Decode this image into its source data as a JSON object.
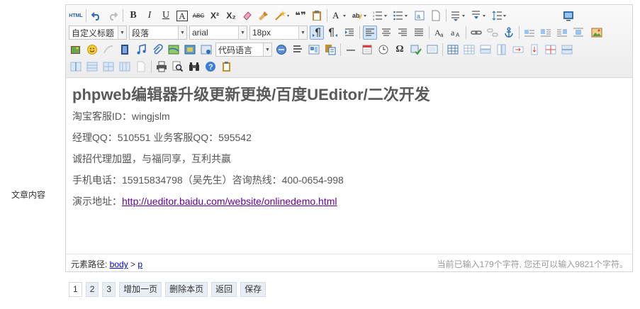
{
  "form": {
    "field_label": "文章内容"
  },
  "toolbar": {
    "row1": {
      "source": "HTML",
      "bold": "B",
      "italic": "I",
      "underline": "U",
      "fontborder": "A",
      "strikethrough": "ABC",
      "superscript": "X²",
      "subscript": "X₂",
      "blockquote": "❝❞"
    },
    "row2": {
      "customstyle": "自定义标题",
      "paragraph": "段落",
      "fontfamily": "arial",
      "fontsize": "18px"
    },
    "row3": {
      "code_language": "代码语言",
      "horizontal": "—",
      "spechars": "Ω"
    }
  },
  "article": {
    "title": "phpweb编辑器升级更新更换/百度UEditor/二次开发",
    "lines": [
      "淘宝客服ID：wingjslm",
      "经理QQ：510551 业务客服QQ：595542",
      "诚招代理加盟，与福同享，互利共赢",
      "手机电话：15915834798（吴先生）咨询热线：400-0654-998"
    ],
    "demo_label": "演示地址：",
    "demo_link": "http://ueditor.baidu.com/website/onlinedemo.html"
  },
  "statusbar": {
    "path_label": "元素路径: ",
    "path_body": "body",
    "path_sep": " > ",
    "path_p": "p",
    "word_count": "当前已输入179个字符, 您还可以输入9821个字符。"
  },
  "pager": {
    "pages": [
      "1",
      "2",
      "3"
    ],
    "add_page": "增加一页",
    "delete_page": "删除本页",
    "back": "返回",
    "save": "保存"
  }
}
